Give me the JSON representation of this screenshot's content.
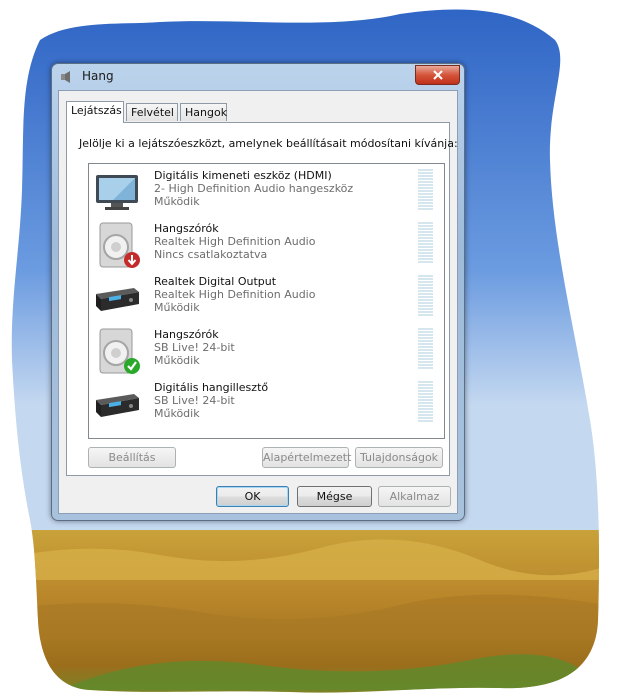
{
  "window": {
    "title": "Hang",
    "close_icon": "close-icon"
  },
  "tabs": [
    {
      "label": "Lejátszás",
      "active": true
    },
    {
      "label": "Felvétel",
      "active": false
    },
    {
      "label": "Hangok",
      "active": false
    }
  ],
  "instruction": "Jelölje ki a lejátszóeszközt, amelynek beállításait módosítani kívánja:",
  "devices": [
    {
      "name": "Digitális kimeneti eszköz (HDMI)",
      "description": "2- High Definition Audio hangeszköz",
      "status": "Működik",
      "icon": "monitor-icon",
      "badge": null
    },
    {
      "name": "Hangszórók",
      "description": "Realtek High Definition Audio",
      "status": "Nincs csatlakoztatva",
      "icon": "speaker-icon",
      "badge": "down-arrow-badge"
    },
    {
      "name": "Realtek Digital Output",
      "description": "Realtek High Definition Audio",
      "status": "Működik",
      "icon": "digital-output-icon",
      "badge": null
    },
    {
      "name": "Hangszórók",
      "description": "SB Live! 24-bit",
      "status": "Működik",
      "icon": "speaker-icon",
      "badge": "check-badge"
    },
    {
      "name": "Digitális hangillesztő",
      "description": "SB Live! 24-bit",
      "status": "Működik",
      "icon": "digital-output-icon",
      "badge": null
    }
  ],
  "panel_buttons": {
    "configure": "Beállítás",
    "set_default": "Alapértelmezett",
    "properties": "Tulajdonságok"
  },
  "dialog_buttons": {
    "ok": "OK",
    "cancel": "Mégse",
    "apply": "Alkalmaz"
  },
  "colors": {
    "close_button": "#c0311a",
    "status_text": "#6d6d6d",
    "check_badge": "#2aa82a",
    "down_badge": "#c42b2b"
  }
}
